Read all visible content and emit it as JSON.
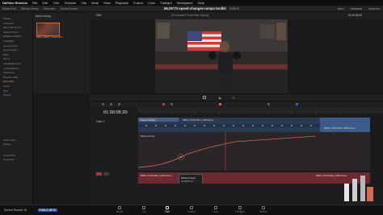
{
  "menubar": {
    "app": "DaVinci Resolve",
    "items": [
      "File",
      "Edit",
      "Trim",
      "Timeline",
      "Clip",
      "Mark",
      "View",
      "Playback",
      "Fusion",
      "Color",
      "Fairlight",
      "Workspace",
      "Help"
    ]
  },
  "toolbar": {
    "items": [
      "Media Pool",
      "Effects Library",
      "Edit Index",
      "Sound Library"
    ],
    "project_title": "MLDKT3-speed-changes-ramps-toolkit",
    "project_status": "Edited",
    "right_items": [
      "Mixer",
      "Metadata",
      "Inspector"
    ]
  },
  "bins": {
    "tab_label": "speed-chang...",
    "items": [
      "Master",
      "Timelines",
      "AE-A-NE-0b-3b",
      "SIDE STORY",
      "SPEED RAMPS",
      "LOGGED",
      "speed ramps",
      "speed ringin...",
      "Gate",
      "Drone",
      "Flashflights Dec",
      "Sound Effects",
      "Interviews",
      "Brandfix MBs",
      "Raw MBs",
      "Preps",
      "BTS",
      "Grades",
      "Power Bins",
      "Master",
      "Smart Bins",
      "Keywords"
    ],
    "selected_index": 14,
    "clip_label": "MIDS_FIRST_SIGHTLC3"
  },
  "viewer": {
    "zoom": "33%",
    "timeline_name": "05 Constant Frame Rate Spiking",
    "timecode": "01:00:05:20"
  },
  "timeline": {
    "timecode": "01:00:05:20",
    "track_video": "Video 1",
    "speed_label": "Speed Change",
    "clip_name": "MIDS_SYNCHRO_1080 Score",
    "curve_label": "Retime Frame",
    "audio_clip_left": "MIDS_SYNCHRO_1080 Score",
    "audio_clip_right": "MIDS_SYNCHRO_1080 Score",
    "tooltip_title": "Retime Frame",
    "tooltip_value": "01:00:05:13"
  },
  "pagenav": {
    "pages": [
      "Media",
      "Cut",
      "Edit",
      "Fusion",
      "Color",
      "Fairlight",
      "Deliver"
    ],
    "active": "Edit",
    "footer_app": "DaVinci Resolve 18",
    "footer_badge": "PUBLIC BETA"
  },
  "colors": {
    "accent": "#d86a55",
    "clip_blue": "#4a6fa8",
    "audio_red": "#7a2c32"
  }
}
